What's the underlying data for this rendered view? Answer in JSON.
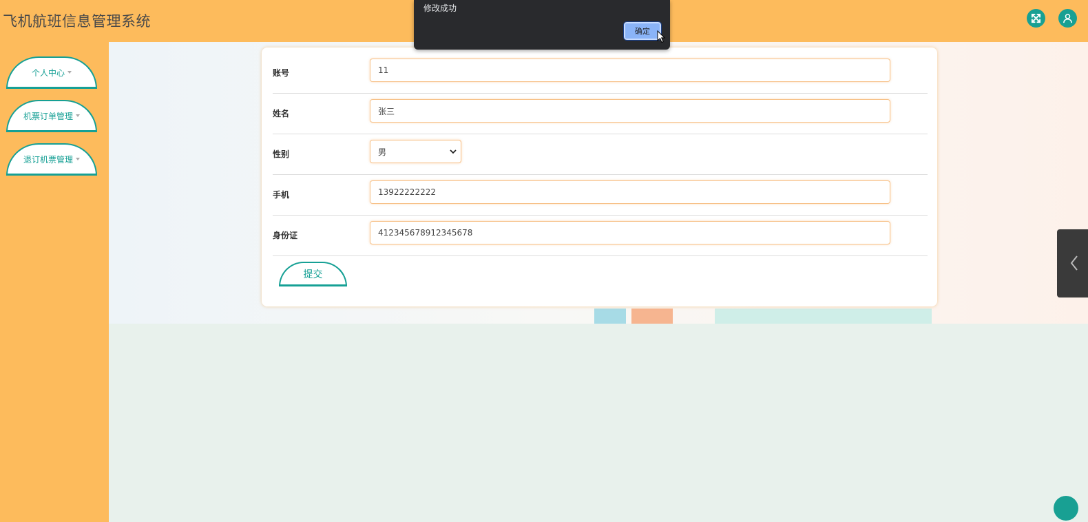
{
  "header": {
    "title": "飞机航班信息管理系统",
    "fullscreen_icon": "expand-icon",
    "user_icon": "user-icon"
  },
  "sidebar": {
    "items": [
      {
        "label": "个人中心"
      },
      {
        "label": "机票订单管理"
      },
      {
        "label": "退订机票管理"
      }
    ]
  },
  "form": {
    "fields": [
      {
        "label": "账号",
        "value": "11"
      },
      {
        "label": "姓名",
        "value": "张三"
      },
      {
        "label": "性别",
        "value": "男"
      },
      {
        "label": "手机",
        "value": "13922222222"
      },
      {
        "label": "身份证",
        "value": "412345678912345678"
      }
    ],
    "submit_label": "提交"
  },
  "dialog": {
    "message": "修改成功",
    "ok_label": "确定"
  },
  "colors": {
    "header_bg": "#fdbb5c",
    "accent": "#16a095",
    "dialog_bg": "#292a2d",
    "dialog_button": "#8ab4f8"
  }
}
